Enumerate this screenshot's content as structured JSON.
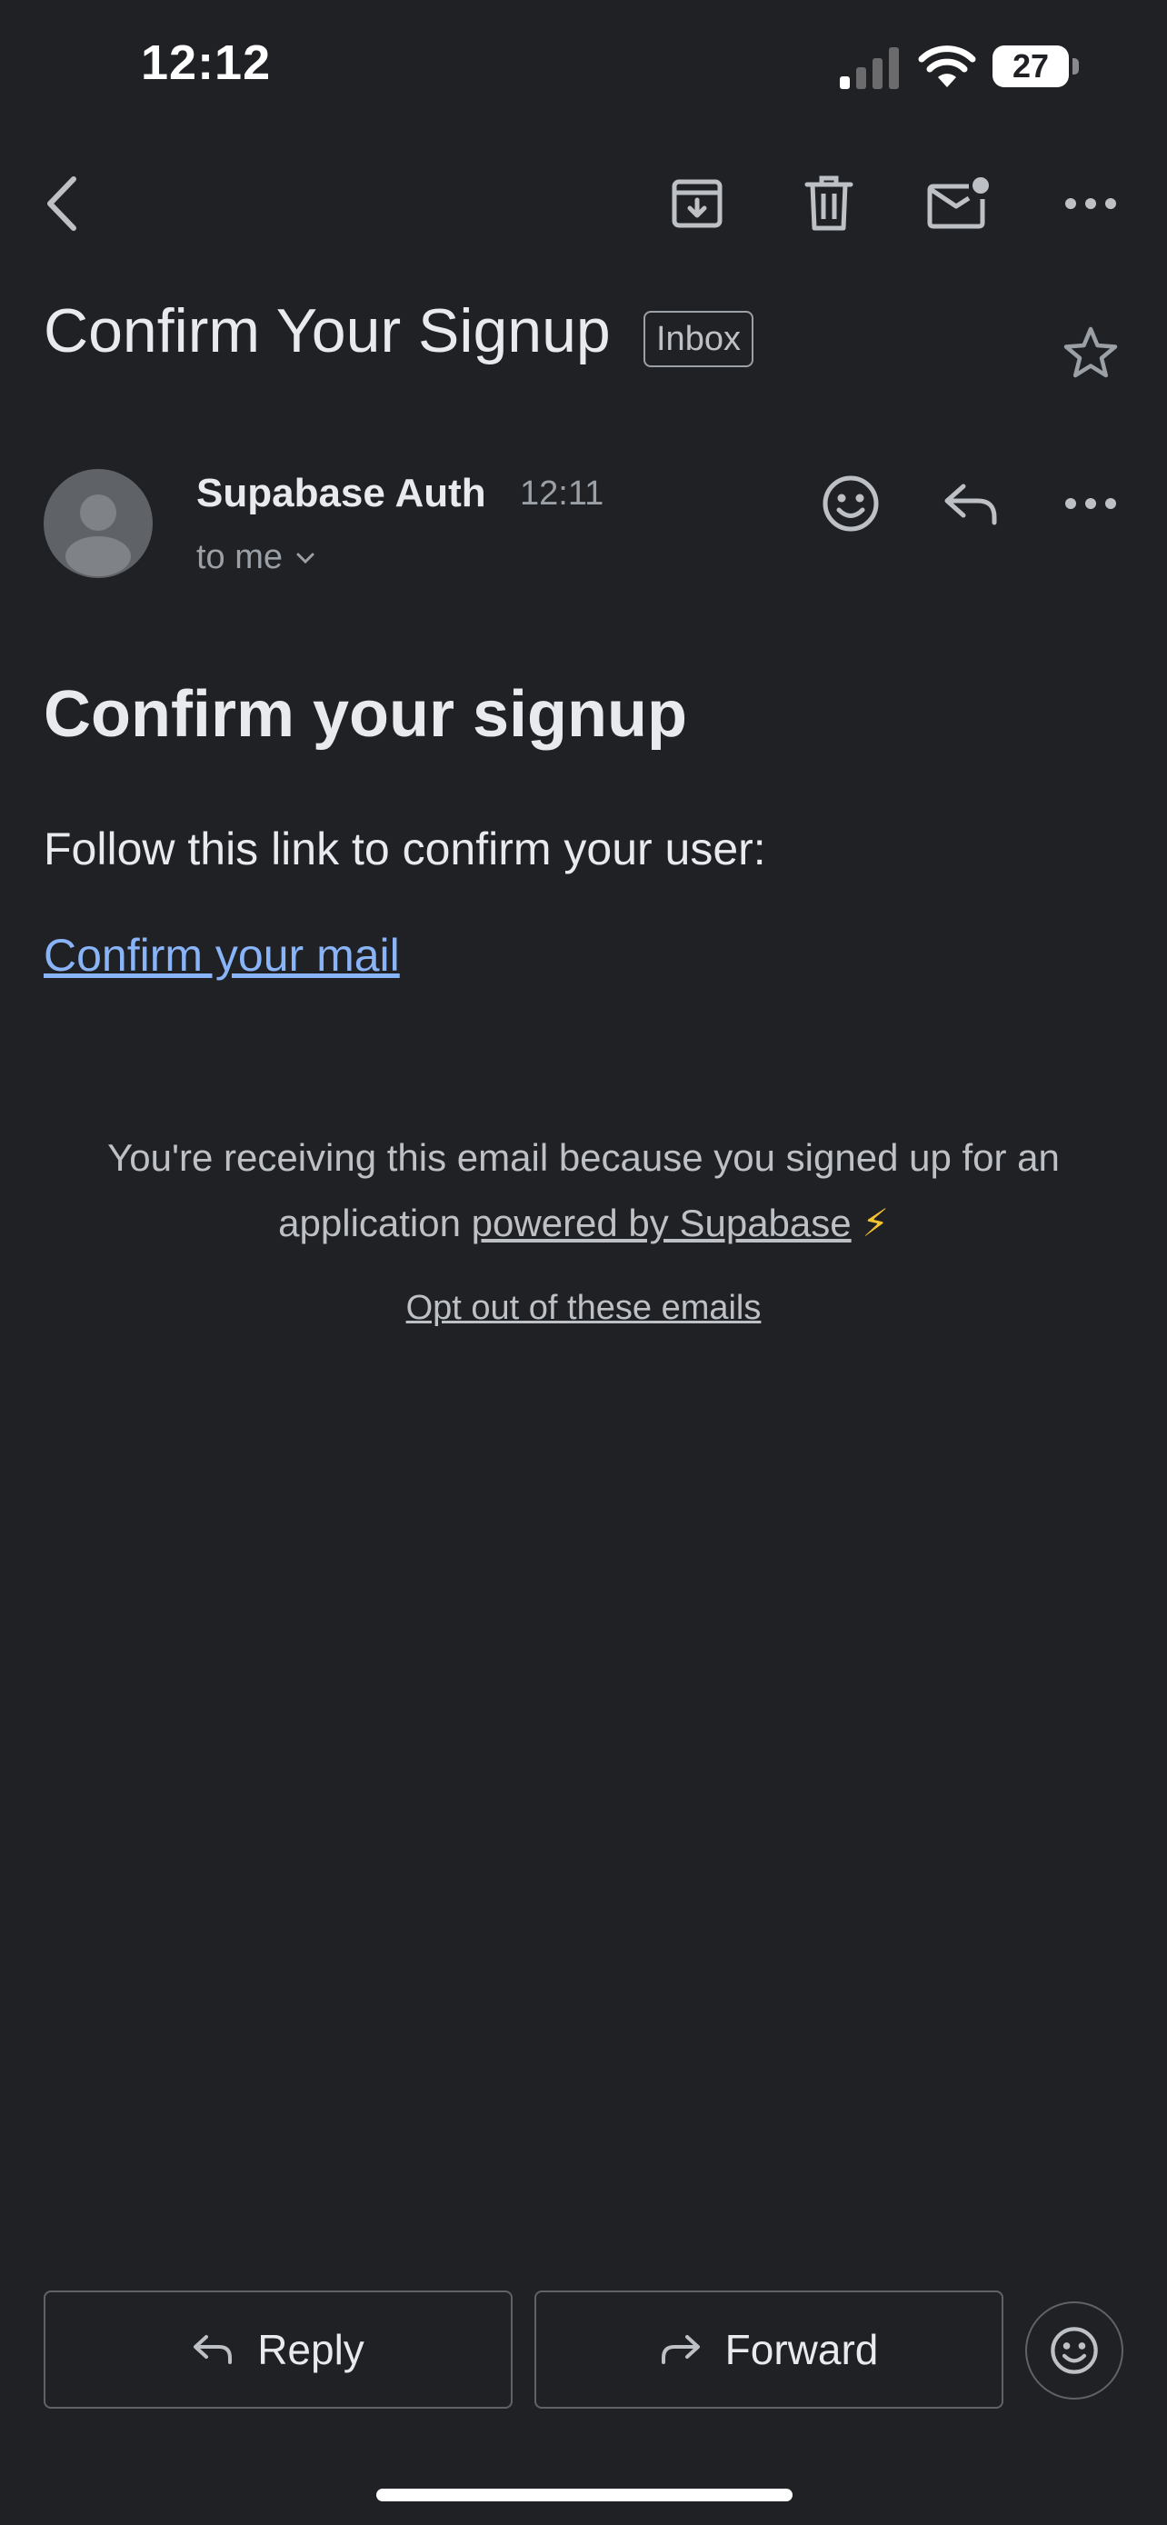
{
  "status_bar": {
    "time": "12:12",
    "battery": "27",
    "icons": [
      "signal-icon",
      "wifi-icon",
      "battery-icon"
    ]
  },
  "toolbar": {
    "icons": [
      "back-arrow-icon",
      "archive-icon",
      "trash-icon",
      "mark-unread-icon",
      "more-options-icon"
    ]
  },
  "email": {
    "subject": "Confirm Your Signup",
    "label": "Inbox",
    "sender": "Supabase Auth",
    "time": "12:11",
    "recipient": "to me",
    "body": {
      "heading": "Confirm your signup",
      "text": "Follow this link to confirm your user:",
      "link": "Confirm your mail",
      "footer_prefix": "You're receiving this email because you signed up for an application",
      "footer_link": "powered by Supabase",
      "footer_emoji": "⚡",
      "optout": "Opt out of these emails"
    }
  },
  "actions": {
    "reply": "Reply",
    "forward": "Forward"
  },
  "colors": {
    "background": "#202124",
    "link": "#8ab4f8",
    "text": "#e8eaed",
    "muted": "#9aa0a6"
  }
}
